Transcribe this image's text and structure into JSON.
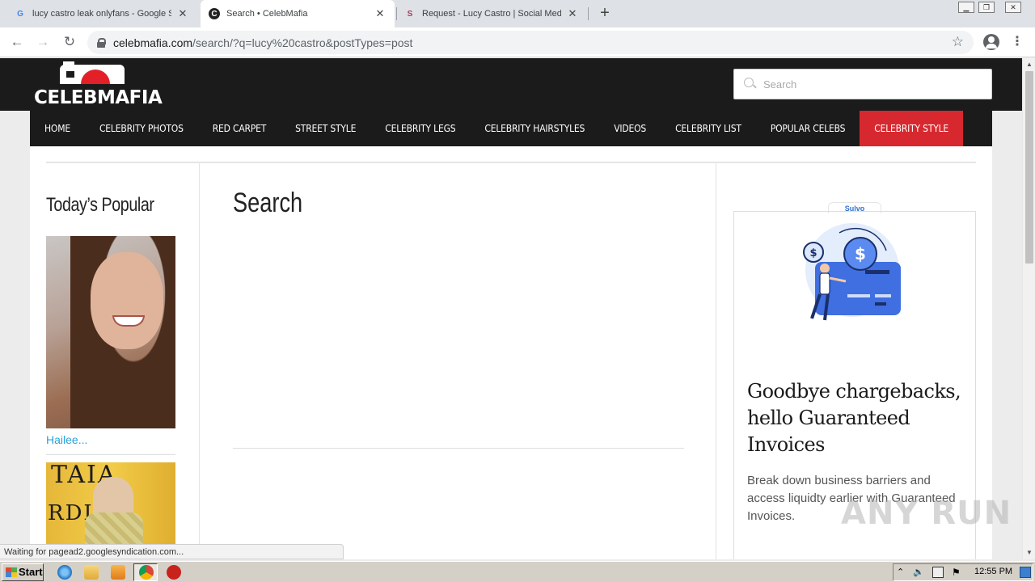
{
  "browser": {
    "tabs": [
      {
        "title": "lucy castro leak onlyfans - Google Se",
        "favicon": "G",
        "active": false
      },
      {
        "title": "Search • CelebMafia",
        "favicon": "C",
        "active": true
      },
      {
        "title": "Request - Lucy Castro | Social Media",
        "favicon": "S",
        "active": false
      }
    ],
    "new_tab": "+",
    "url_host": "celebmafia.com",
    "url_path": "/search/?q=lucy%20castro&postTypes=post"
  },
  "site": {
    "logo_text": "CELEBMAFIA",
    "search_placeholder": "Search",
    "nav": [
      {
        "label": "HOME",
        "highlight": false
      },
      {
        "label": "CELEBRITY PHOTOS",
        "highlight": false
      },
      {
        "label": "RED CARPET",
        "highlight": false
      },
      {
        "label": "STREET STYLE",
        "highlight": false
      },
      {
        "label": "CELEBRITY LEGS",
        "highlight": false
      },
      {
        "label": "CELEBRITY HAIRSTYLES",
        "highlight": false
      },
      {
        "label": "VIDEOS",
        "highlight": false
      },
      {
        "label": "CELEBRITY LIST",
        "highlight": false
      },
      {
        "label": "POPULAR CELEBS",
        "highlight": false
      },
      {
        "label": "CELEBRITY STYLE",
        "highlight": true
      }
    ],
    "sidebar_title": "Today’s Popular",
    "popular": [
      {
        "caption": "Hailee..."
      },
      {
        "caption": ""
      }
    ],
    "photo2_letters": [
      "TAIA",
      "RDI"
    ],
    "main_title": "Search",
    "ad": {
      "brand": "Sulvo",
      "headline": "Goodbye chargebacks, hello Guaranteed Invoices",
      "body": "Break down business barriers and access liquidty earlier with Guaranteed Invoices."
    },
    "watermark": "ANY RUN"
  },
  "status_text": "Waiting for pagead2.googlesyndication.com...",
  "taskbar": {
    "start_label": "Start",
    "clock": "12:55 PM"
  },
  "colors": {
    "header_bg": "#1b1b1b",
    "accent_red": "#d7282f",
    "link_blue": "#27a3d8"
  }
}
